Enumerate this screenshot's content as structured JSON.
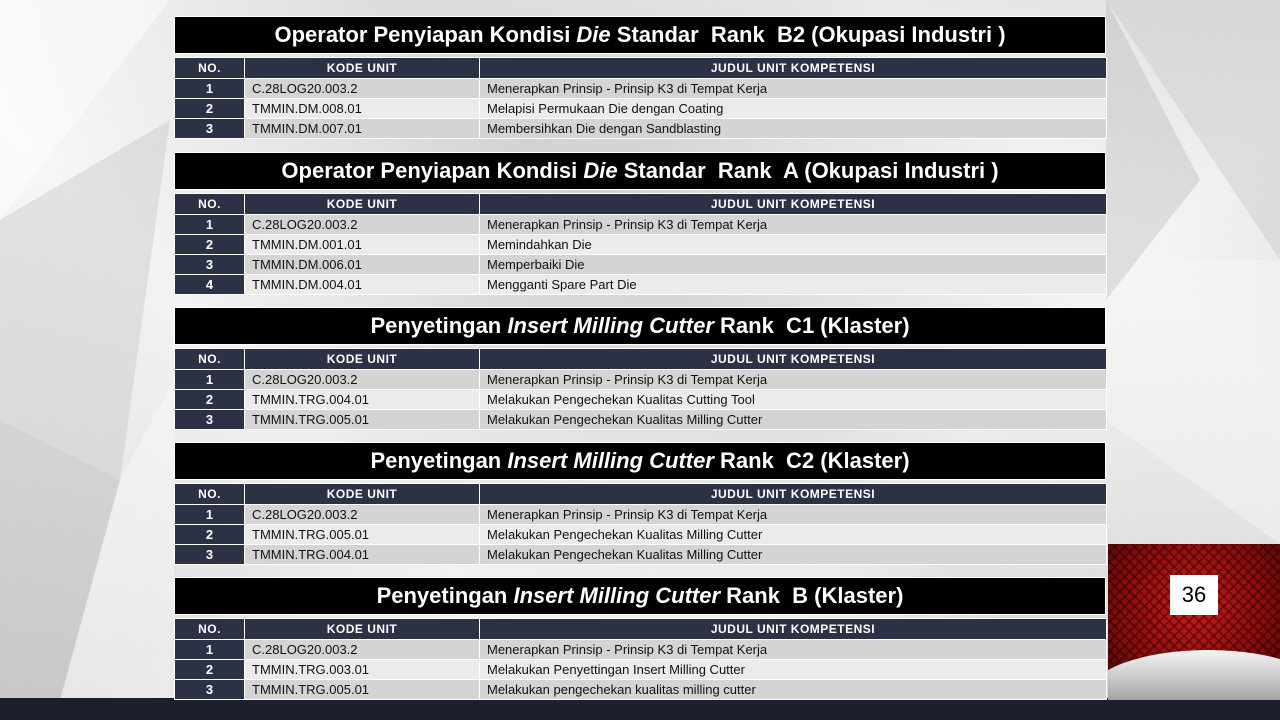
{
  "page_number": "36",
  "columns": {
    "no": "NO.",
    "kode": "KODE UNIT",
    "judul": "JUDUL UNIT KOMPETENSI"
  },
  "sections": [
    {
      "title_pre": "Operator Penyiapan Kondisi ",
      "title_em": "Die",
      "title_post": " Standar  Rank  B2 (Okupasi Industri )",
      "rows": [
        {
          "no": "1",
          "kode": "C.28LOG20.003.2",
          "judul": "Menerapkan Prinsip - Prinsip K3 di Tempat Kerja"
        },
        {
          "no": "2",
          "kode": "TMMIN.DM.008.01",
          "judul": "Melapisi Permukaan Die dengan Coating"
        },
        {
          "no": "3",
          "kode": "TMMIN.DM.007.01",
          "judul": "Membersihkan Die dengan Sandblasting"
        }
      ]
    },
    {
      "title_pre": "Operator Penyiapan Kondisi ",
      "title_em": "Die",
      "title_post": " Standar  Rank  A (Okupasi Industri )",
      "rows": [
        {
          "no": "1",
          "kode": "C.28LOG20.003.2",
          "judul": "Menerapkan Prinsip - Prinsip K3 di Tempat Kerja"
        },
        {
          "no": "2",
          "kode": "TMMIN.DM.001.01",
          "judul": "Memindahkan Die"
        },
        {
          "no": "3",
          "kode": "TMMIN.DM.006.01",
          "judul": "Memperbaiki Die"
        },
        {
          "no": "4",
          "kode": "TMMIN.DM.004.01",
          "judul": "Mengganti  Spare Part Die"
        }
      ]
    },
    {
      "title_pre": "Penyetingan ",
      "title_em": "Insert Milling Cutter",
      "title_post": " Rank  C1 (Klaster)",
      "rows": [
        {
          "no": "1",
          "kode": "C.28LOG20.003.2",
          "judul": "Menerapkan Prinsip - Prinsip K3 di Tempat Kerja"
        },
        {
          "no": "2",
          "kode": "TMMIN.TRG.004.01",
          "judul": "Melakukan  Pengechekan Kualitas Cutting Tool"
        },
        {
          "no": "3",
          "kode": "TMMIN.TRG.005.01",
          "judul": "Melakukan  Pengechekan Kualitas Milling  Cutter"
        }
      ]
    },
    {
      "title_pre": "Penyetingan ",
      "title_em": "Insert Milling Cutter",
      "title_post": " Rank  C2 (Klaster)",
      "rows": [
        {
          "no": "1",
          "kode": "C.28LOG20.003.2",
          "judul": "Menerapkan Prinsip - Prinsip K3 di Tempat Kerja"
        },
        {
          "no": "2",
          "kode": "TMMIN.TRG.005.01",
          "judul": "Melakukan  Pengechekan Kualitas Milling  Cutter"
        },
        {
          "no": "3",
          "kode": "TMMIN.TRG.004.01",
          "judul": "Melakukan  Pengechekan Kualitas Milling  Cutter"
        }
      ]
    },
    {
      "title_pre": "Penyetingan ",
      "title_em": "Insert Milling Cutter",
      "title_post": " Rank  B (Klaster)",
      "rows": [
        {
          "no": "1",
          "kode": "C.28LOG20.003.2",
          "judul": "Menerapkan Prinsip - Prinsip K3 di Tempat Kerja"
        },
        {
          "no": "2",
          "kode": "TMMIN.TRG.003.01",
          "judul": "Melakukan  Penyettingan Insert Milling  Cutter"
        },
        {
          "no": "3",
          "kode": "TMMIN.TRG.005.01",
          "judul": "Melakukan  pengechekan kualitas milling cutter"
        }
      ]
    }
  ]
}
